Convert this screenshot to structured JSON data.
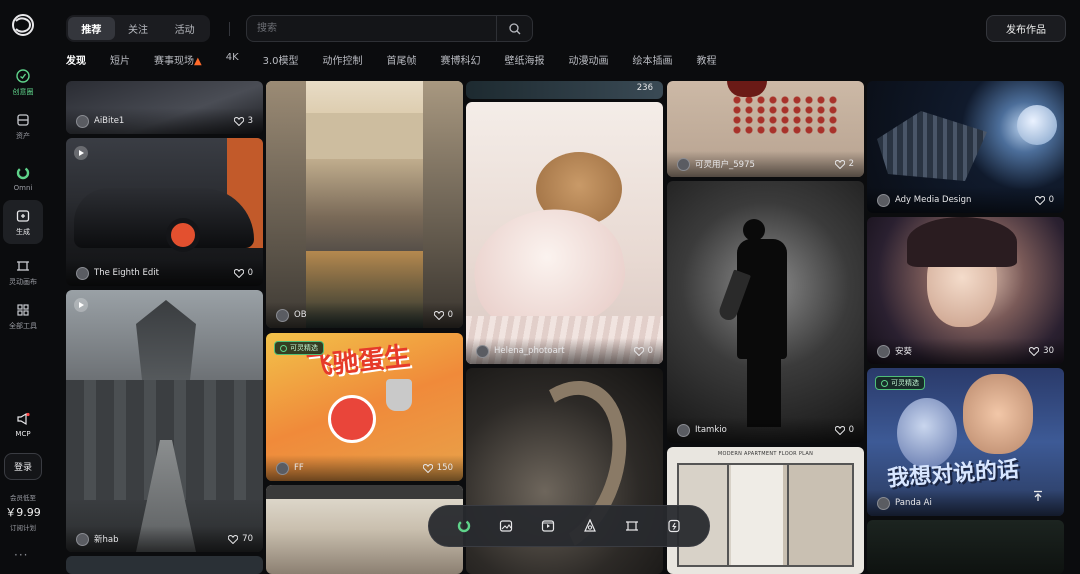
{
  "sidebar": {
    "items": [
      {
        "label": "创意圈",
        "icon": "compass-icon"
      },
      {
        "label": "资产",
        "icon": "folder-icon"
      },
      {
        "label": "Omni",
        "icon": "omni-ring-icon"
      },
      {
        "label": "生成",
        "icon": "generate-icon"
      },
      {
        "label": "灵动画布",
        "icon": "canvas-icon"
      },
      {
        "label": "全部工具",
        "icon": "grid-icon"
      },
      {
        "label": "MCP",
        "icon": "megaphone-icon"
      }
    ],
    "login": "登录",
    "member_title": "会员低至",
    "member_price": "￥9.99",
    "member_sub": "订阅计划",
    "more": "···"
  },
  "header": {
    "tabs": [
      "推荐",
      "关注",
      "活动"
    ],
    "search_placeholder": "搜索",
    "publish": "发布作品"
  },
  "categories": [
    "发现",
    "短片",
    "赛事现场",
    "4K",
    "3.0模型",
    "动作控制",
    "首尾帧",
    "赛博科幻",
    "壁纸海报",
    "动漫动画",
    "绘本插画",
    "教程"
  ],
  "cards": {
    "c1": {
      "user": "AiBite1",
      "likes": "3"
    },
    "c2": {
      "user": "The Eighth Edit",
      "likes": "0"
    },
    "c3": {
      "user": "新hab",
      "likes": "70"
    },
    "c4": {
      "user": "OB",
      "likes": "0"
    },
    "c5": {
      "user": "FF",
      "likes": "150",
      "badge": "可灵精选",
      "text": "飞驰蛋生"
    },
    "c6": {
      "user": "Helena_photoart",
      "likes": "0"
    },
    "c7": {
      "user": "可灵用户_5975",
      "likes": "2"
    },
    "c8": {
      "user": "Itamkio",
      "likes": "0"
    },
    "c9": {
      "title": "MODERN APARTMENT FLOOR PLAN"
    },
    "c10": {
      "user": "Ady Media Design",
      "likes": "0"
    },
    "c11": {
      "user": "安葵",
      "likes": "30"
    },
    "c12": {
      "user": "Panda Ai",
      "badge": "可灵精选",
      "text": "我想对说的话"
    },
    "c0b": {
      "likes": "236"
    }
  },
  "toolbar": [
    "omni-ring-icon",
    "image-icon",
    "video-frame-icon",
    "effects-icon",
    "crop-icon",
    "sound-icon"
  ],
  "colors": {
    "accent": "#5fd38a",
    "background": "#0b0c0e"
  }
}
